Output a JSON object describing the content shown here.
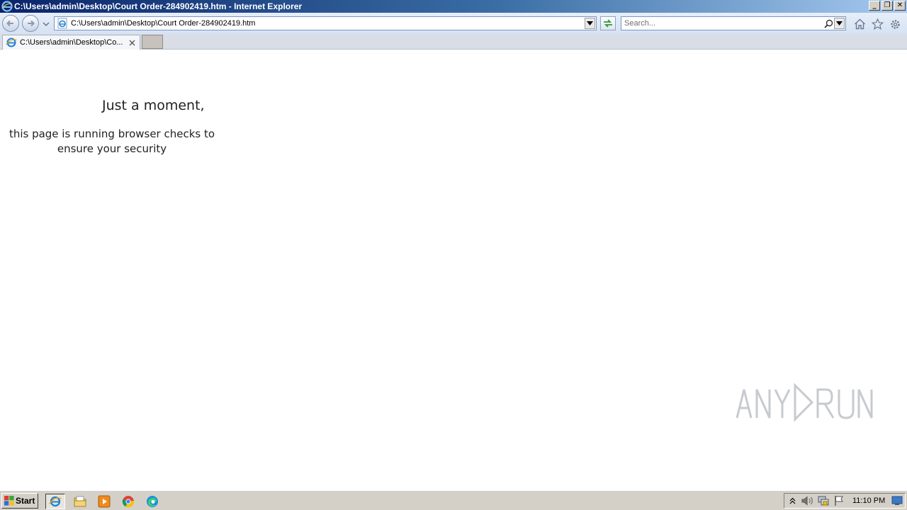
{
  "window": {
    "title": "C:\\Users\\admin\\Desktop\\Court Order-284902419.htm - Internet Explorer",
    "minimize_glyph": "_",
    "maximize_glyph": "❐",
    "close_glyph": "✕"
  },
  "toolbar": {
    "address": "C:\\Users\\admin\\Desktop\\Court Order-284902419.htm",
    "search_placeholder": "Search..."
  },
  "tabs": [
    {
      "title": "C:\\Users\\admin\\Desktop\\Co..."
    }
  ],
  "page": {
    "heading": "Just a moment,",
    "line1": "this page is running browser checks to",
    "line2": "ensure your security"
  },
  "taskbar": {
    "start_label": "Start",
    "clock": "11:10 PM"
  },
  "watermark": "ANY RUN",
  "colors": {
    "title_gradient_start": "#0a246a",
    "title_gradient_end": "#a6caf0",
    "taskbar": "#d4d0c8",
    "ie_blue": "#1e7fd6"
  }
}
